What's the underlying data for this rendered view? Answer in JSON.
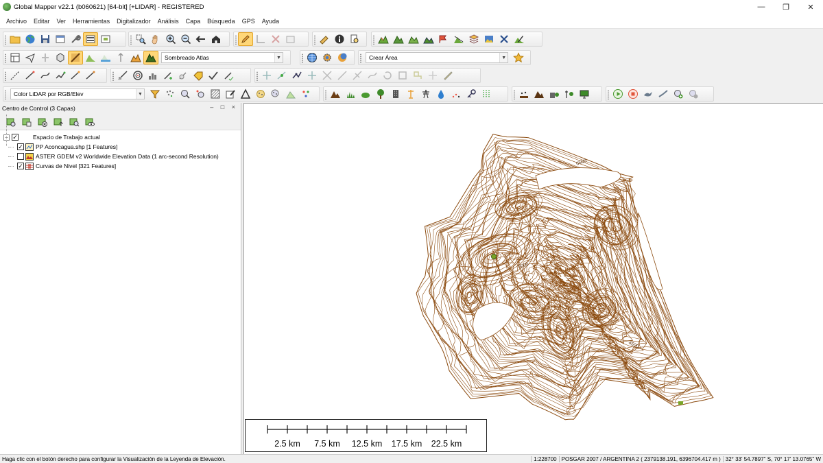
{
  "window": {
    "title": "Global Mapper  v22.1 (b060621) [64-bit] [+LIDAR] - REGISTERED",
    "minimize_icon": "minimize-icon",
    "maximize_icon": "restore-icon",
    "close_icon": "close-icon"
  },
  "menu": [
    "Archivo",
    "Editar",
    "Ver",
    "Herramientas",
    "Digitalizador",
    "Análisis",
    "Capa",
    "Búsqueda",
    "GPS",
    "Ayuda"
  ],
  "toolbars": {
    "shader_select": "Sombreado Atlas",
    "area_select": "Crear Área",
    "lidar_color_select": "Color LiDAR por RGB/Elev"
  },
  "control_center": {
    "title": "Centro de Control (3 Capas)",
    "pane_controls": "– □ ×",
    "workspace": {
      "label": "Espacio de Trabajo actual",
      "checked": true,
      "expander": "–"
    },
    "layers": [
      {
        "label": "PP Aconcagua.shp [1 Features]",
        "checked": true,
        "icon": "point-layer-icon"
      },
      {
        "label": "ASTER GDEM v2 Worldwide Elevation Data (1 arc-second Resolution)",
        "checked": false,
        "icon": "elevation-layer-icon"
      },
      {
        "label": "Curvas de Nivel [321 Features]",
        "checked": true,
        "icon": "contour-layer-icon"
      }
    ]
  },
  "scalebar": {
    "labels": [
      "2.5 km",
      "7.5 km",
      "12.5 km",
      "17.5 km",
      "22.5 km"
    ]
  },
  "map": {
    "contour_color": "#8b4a0e",
    "label_1": "6500",
    "label_2": "5000",
    "label_3": "4500",
    "point_color": "#7aa628"
  },
  "status": {
    "hint": "Haga clic con el botón derecho para configurar la Visualización de la Leyenda de Elevación.",
    "scale": "1:228700",
    "projection": "POSGAR 2007 / ARGENTINA 2 ( 2379138.191, 6396704.417 m )",
    "coords": "32° 33' 54.7897\" S, 70° 17' 13.0765\" W"
  }
}
